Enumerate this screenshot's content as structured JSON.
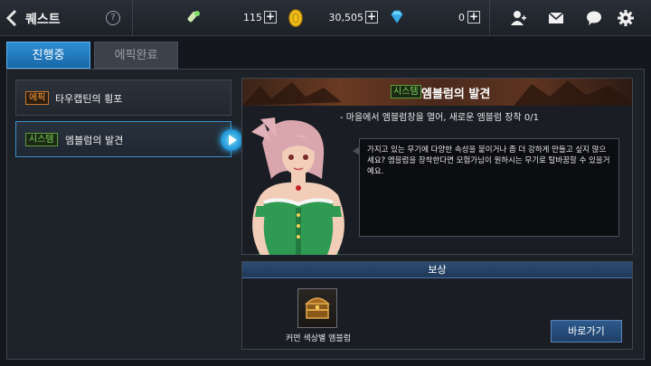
{
  "header": {
    "title": "퀘스트",
    "help_label": "?",
    "resources": [
      {
        "name": "stamina",
        "value": "115",
        "icon": "flashlight-icon"
      },
      {
        "name": "gold",
        "value": "30,505",
        "icon": "gold-coin-icon"
      },
      {
        "name": "gem",
        "value": "0",
        "icon": "diamond-icon"
      }
    ],
    "plus_label": "+"
  },
  "tabs": [
    {
      "label": "진행중",
      "active": true
    },
    {
      "label": "에픽완료",
      "active": false
    }
  ],
  "quests": [
    {
      "tag": "에픽",
      "label": "타우캡틴의 횡포",
      "selected": false
    },
    {
      "tag": "시스템",
      "label": "엠블럼의 발견",
      "selected": true
    }
  ],
  "detail": {
    "tag": "시스템",
    "title": "엠블럼의 발견",
    "objective": "- 마을에서 엠블럼창을 열어, 새로운 엠블럼 장착 0/1",
    "dialogue": "가지고 있는 무기에 다양한 속성을 붙이거나 좀 더 강하게 만들고 싶지 않으세요?  엠블럼을 장착한다면 모험가님이 원하시는 무기로 탈바꿈할 수 있을거예요."
  },
  "reward": {
    "header": "보상",
    "item_name": "커먼 색상별 엠블럼",
    "go_button": "바로가기"
  },
  "colors": {
    "accent": "#1f7fc4",
    "epic": "#ff9c3a",
    "system": "#7fd35a"
  }
}
